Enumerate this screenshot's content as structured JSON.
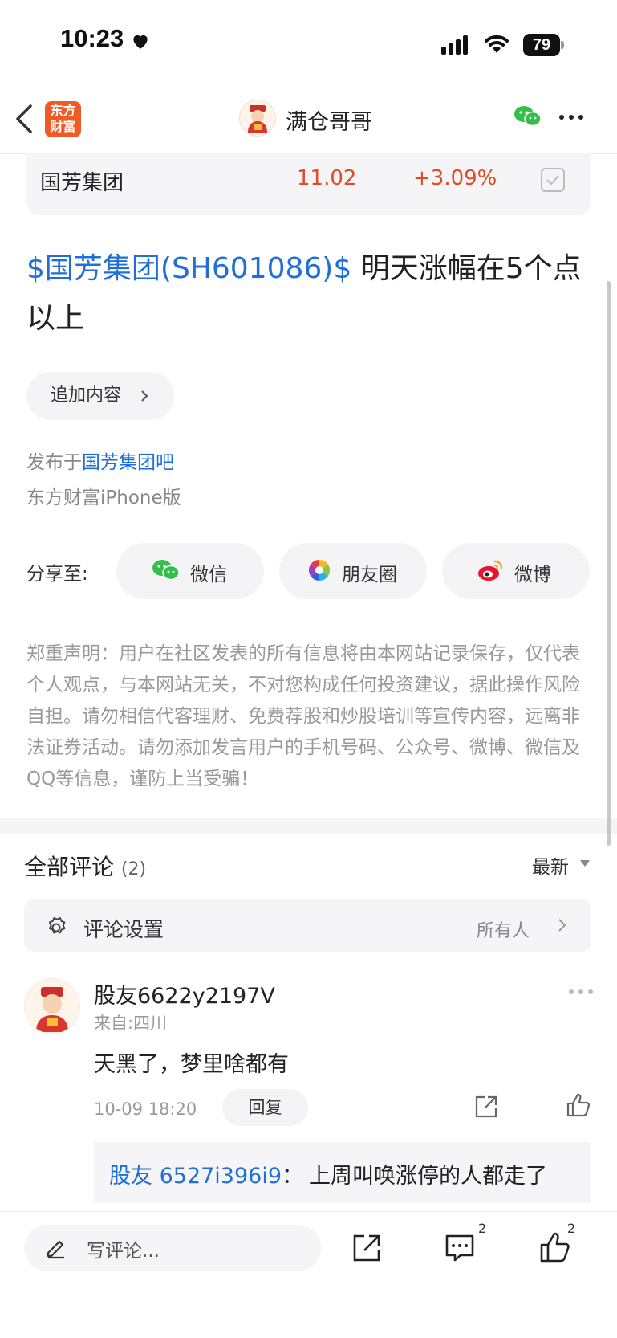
{
  "status_bar": {
    "time": "10:23",
    "battery": "79"
  },
  "nav": {
    "logo_line1": "东方",
    "logo_line2": "财富",
    "title": "满仓哥哥"
  },
  "stock": {
    "name": "国芳集团",
    "price": "11.02",
    "change": "+3.09%"
  },
  "post": {
    "tag": "$国芳集团(SH601086)$",
    "text": " 明天涨幅在5个点以上"
  },
  "add_content": "追加内容",
  "published": {
    "prefix": "发布于",
    "bar": "国芳集团吧",
    "device": "东方财富iPhone版"
  },
  "share": {
    "label": "分享至:",
    "targets": [
      {
        "label": "微信",
        "icon": "wechat-icon"
      },
      {
        "label": "朋友圈",
        "icon": "moments-icon"
      },
      {
        "label": "微博",
        "icon": "weibo-icon"
      }
    ]
  },
  "disclaimer": "郑重声明：用户在社区发表的所有信息将由本网站记录保存，仅代表个人观点，与本网站无关，不对您构成任何投资建议，据此操作风险自担。请勿相信代客理财、免费荐股和炒股培训等宣传内容，远离非法证券活动。请勿添加发言用户的手机号码、公众号、微博、微信及QQ等信息，谨防上当受骗！",
  "comments": {
    "title": "全部评论",
    "count": "(2)",
    "sort": "最新",
    "settings_label": "评论设置",
    "settings_value": "所有人",
    "items": [
      {
        "user": "股友6622y2197V",
        "from": "来自:四川",
        "text": "天黑了，梦里啥都有",
        "time": "10-09 18:20",
        "reply_label": "回复",
        "sub_reply": {
          "user": "股友 6527i396i9",
          "sep": "：",
          "text": "上周叫唤涨停的人都走了"
        }
      }
    ]
  },
  "bottom_bar": {
    "placeholder": "写评论...",
    "comment_count": "2",
    "like_count": "2"
  },
  "colors": {
    "accent_blue": "#1f6fd6",
    "rise_red": "#e24b26",
    "brand_orange": "#f05a24"
  }
}
